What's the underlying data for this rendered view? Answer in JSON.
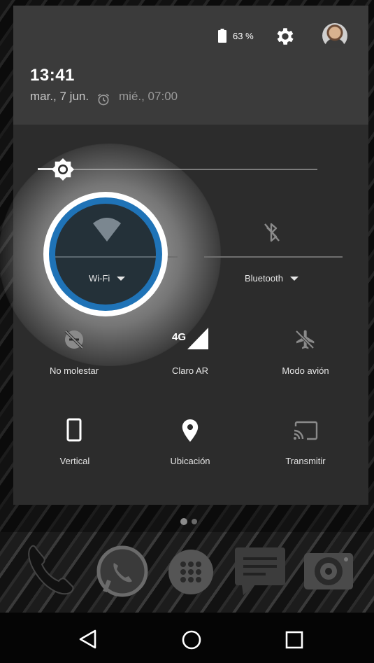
{
  "status": {
    "battery_text": "63 %"
  },
  "header": {
    "time": "13:41",
    "date": "mar., 7 jun.",
    "alarm": "mié., 07:00"
  },
  "brightness": {
    "level": 0.1
  },
  "tiles": {
    "wifi": {
      "label": "Wi-Fi",
      "active": true
    },
    "bluetooth": {
      "label": "Bluetooth",
      "active": false
    },
    "dnd": {
      "label": "No molestar"
    },
    "network": {
      "label": "Claro AR",
      "badge": "4G"
    },
    "airplane": {
      "label": "Modo avión"
    },
    "rotation": {
      "label": "Vertical"
    },
    "location": {
      "label": "Ubicación"
    },
    "cast": {
      "label": "Transmitir"
    }
  },
  "colors": {
    "accent": "#1f73b7",
    "shade_header": "#3b3b3b",
    "shade_panel": "#2c2c2c"
  },
  "icons": [
    "battery-icon",
    "settings-icon",
    "avatar",
    "alarm-icon",
    "brightness-icon",
    "wifi-icon",
    "bluetooth-icon",
    "do-not-disturb-icon",
    "signal-icon",
    "airplane-icon",
    "rotation-icon",
    "location-icon",
    "cast-icon",
    "phone-icon",
    "whatsapp-icon",
    "apps-icon",
    "messages-icon",
    "camera-icon",
    "back-icon",
    "home-icon",
    "recents-icon"
  ]
}
